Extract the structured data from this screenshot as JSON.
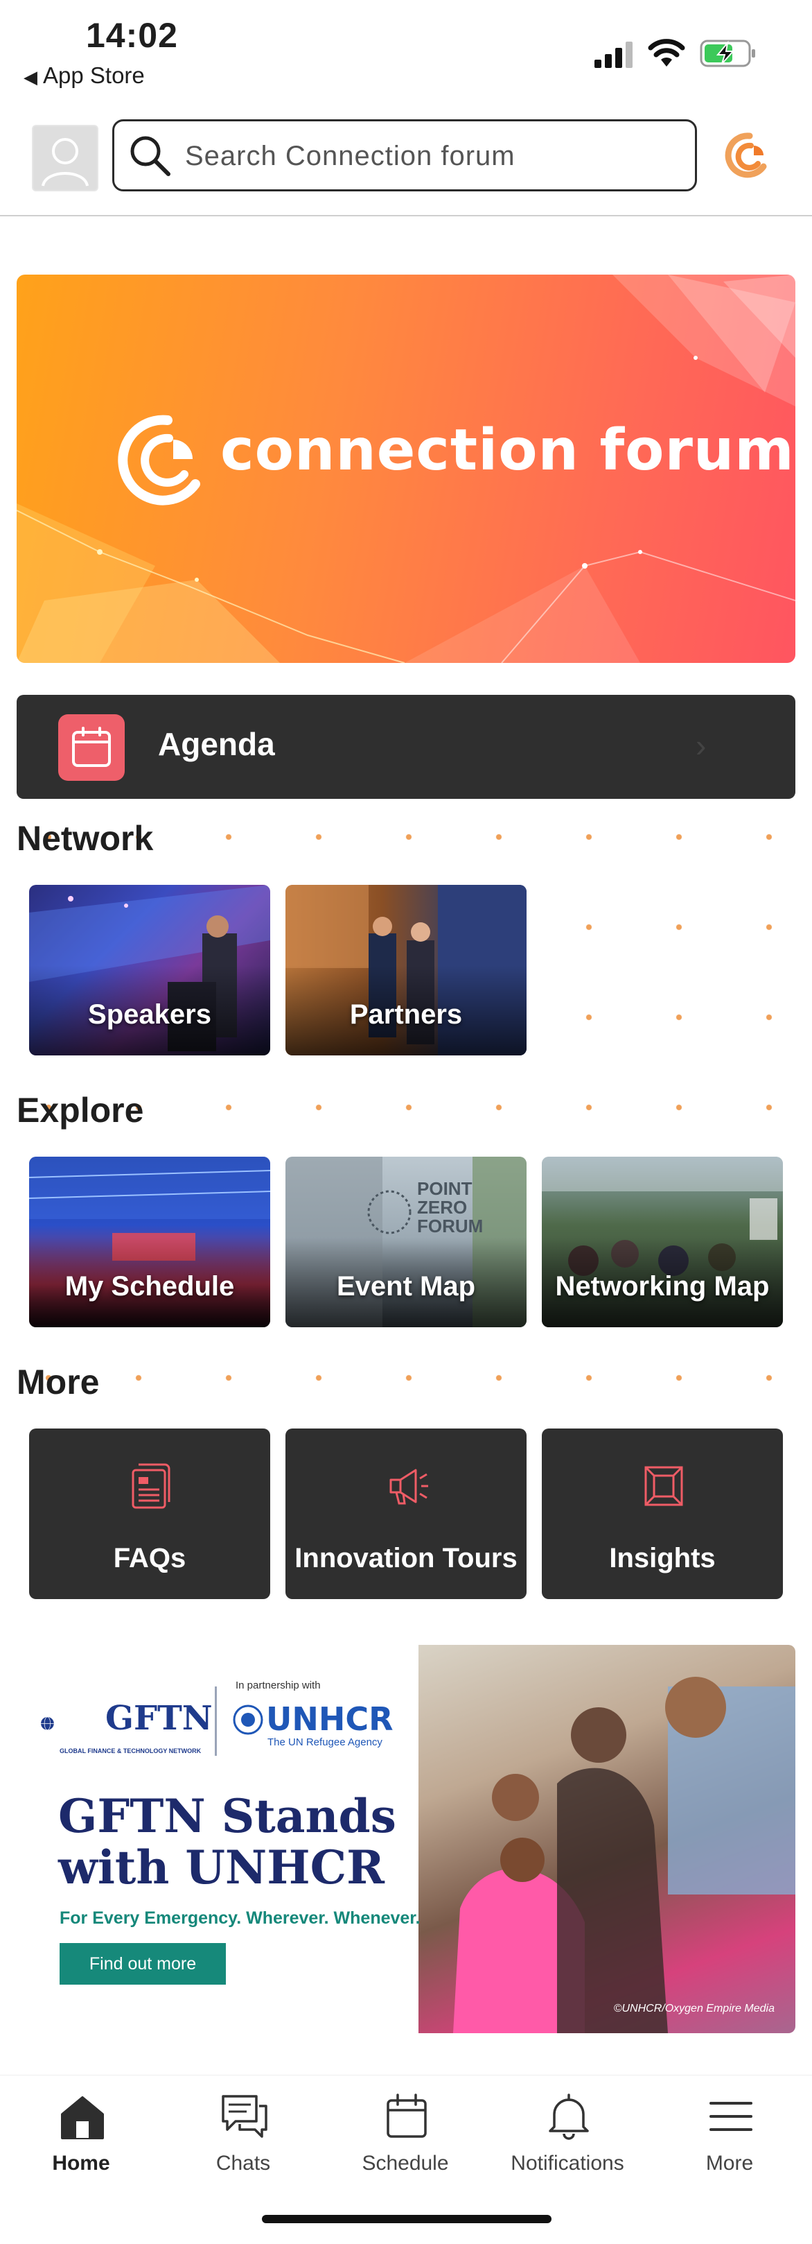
{
  "status_bar": {
    "time": "14:02",
    "back_label": "App Store"
  },
  "header": {
    "search_placeholder": "Search Connection forum"
  },
  "hero": {
    "title": "connection forum"
  },
  "agenda": {
    "label": "Agenda"
  },
  "sections": {
    "network": {
      "title": "Network",
      "tiles": [
        {
          "label": "Speakers"
        },
        {
          "label": "Partners"
        }
      ]
    },
    "explore": {
      "title": "Explore",
      "tiles": [
        {
          "label": "My Schedule"
        },
        {
          "label": "Event Map"
        },
        {
          "label": "Networking Map"
        }
      ]
    },
    "more": {
      "title": "More",
      "tiles": [
        {
          "label": "FAQs",
          "icon": "document-icon"
        },
        {
          "label": "Innovation Tours",
          "icon": "megaphone-icon"
        },
        {
          "label": "Insights",
          "icon": "frame-icon"
        }
      ]
    }
  },
  "banner": {
    "gftn": "GFTN",
    "gftn_sub": "GLOBAL FINANCE & TECHNOLOGY NETWORK",
    "partnership": "In partnership with",
    "unhcr": "UNHCR",
    "unhcr_sub": "The UN Refugee Agency",
    "title": "GFTN Stands with UNHCR",
    "tagline": "For Every Emergency. Wherever. Whenever.",
    "button": "Find out more",
    "credit": "©UNHCR/Oxygen Empire Media"
  },
  "tabbar": {
    "items": [
      {
        "label": "Home",
        "icon": "home-icon",
        "active": true
      },
      {
        "label": "Chats",
        "icon": "chat-icon"
      },
      {
        "label": "Schedule",
        "icon": "calendar-icon"
      },
      {
        "label": "Notifications",
        "icon": "bell-icon"
      },
      {
        "label": "More",
        "icon": "menu-icon"
      }
    ]
  },
  "colors": {
    "accent": "#ee5f6a",
    "dark_tile": "#2f2f2f",
    "hero_start": "#ffa21a",
    "hero_end": "#ff5560"
  }
}
